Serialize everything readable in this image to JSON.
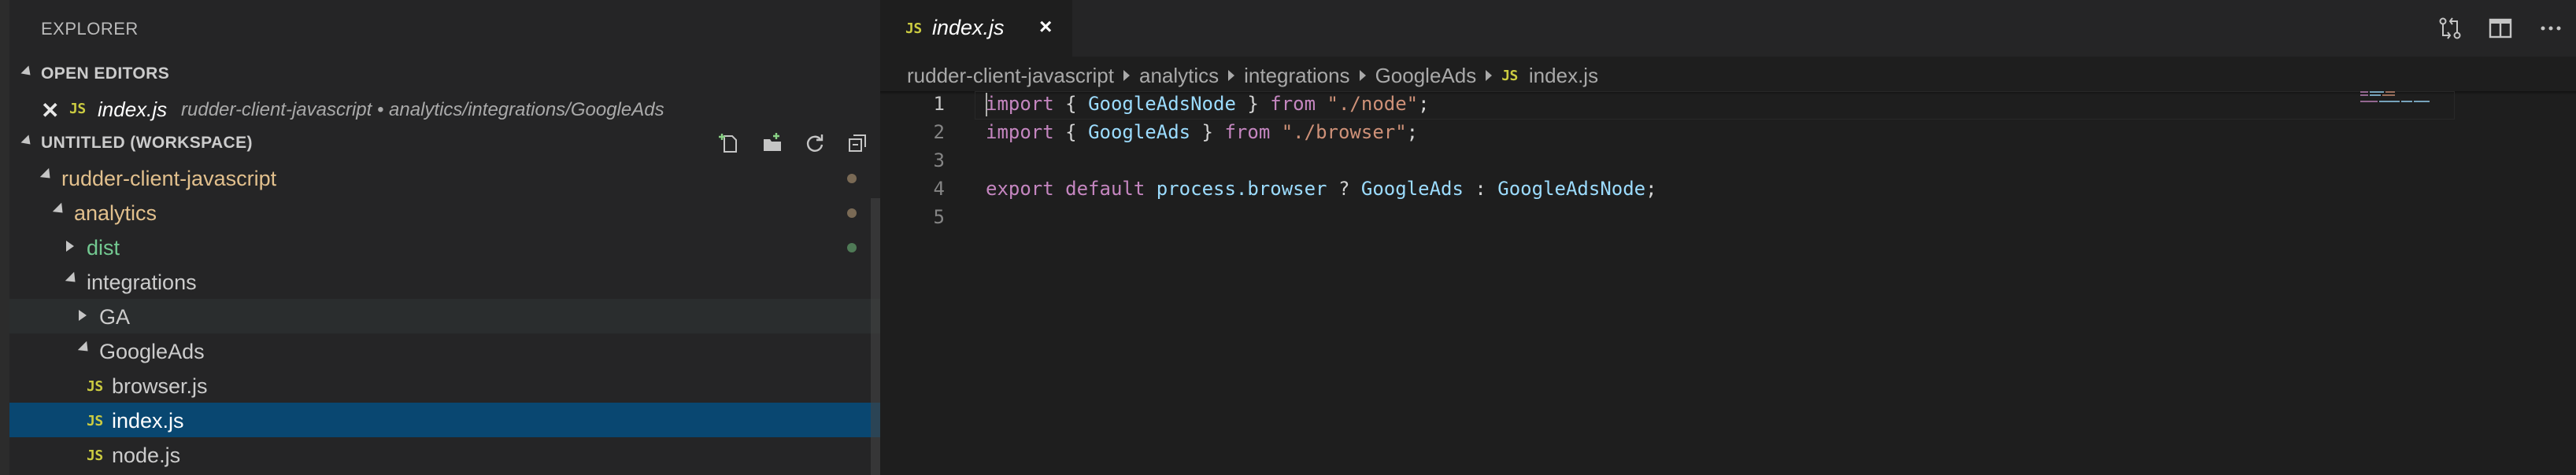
{
  "sidebar": {
    "title": "EXPLORER",
    "open_editors": {
      "header": "OPEN EDITORS",
      "items": [
        {
          "badge": "JS",
          "name": "index.js",
          "path": "rudder-client-javascript • analytics/integrations/GoogleAds"
        }
      ]
    },
    "workspace": {
      "header": "UNTITLED (WORKSPACE)",
      "tree": [
        {
          "label": "rudder-client-javascript",
          "color": "#e2c08d",
          "dot": "#7a6a55"
        },
        {
          "label": "analytics",
          "color": "#e2c08d",
          "dot": "#7a6a55"
        },
        {
          "label": "dist",
          "color": "#73c991",
          "dot": "#4f7a56"
        },
        {
          "label": "integrations",
          "color": "#cccccc"
        },
        {
          "label": "GA",
          "color": "#cccccc"
        },
        {
          "label": "GoogleAds",
          "color": "#cccccc"
        },
        {
          "badge": "JS",
          "label": "browser.js",
          "color": "#cccccc"
        },
        {
          "badge": "JS",
          "label": "index.js",
          "color": "#ffffff"
        },
        {
          "badge": "JS",
          "label": "node.js",
          "color": "#cccccc"
        }
      ]
    }
  },
  "editor": {
    "tab": {
      "badge": "JS",
      "label": "index.js",
      "close": "×"
    },
    "breadcrumb": {
      "items": [
        "rudder-client-javascript",
        "analytics",
        "integrations",
        "GoogleAds"
      ],
      "file_badge": "JS",
      "file": "index.js"
    },
    "lines": [
      {
        "n": "1",
        "t1": "import",
        "t2": " { ",
        "t3": "GoogleAdsNode",
        "t4": " } ",
        "t5": "from",
        "t6": " ",
        "t7": "\"./node\"",
        "t8": ";"
      },
      {
        "n": "2",
        "t1": "import",
        "t2": " { ",
        "t3": "GoogleAds",
        "t4": " } ",
        "t5": "from",
        "t6": " ",
        "t7": "\"./browser\"",
        "t8": ";"
      },
      {
        "n": "3"
      },
      {
        "n": "4",
        "t1": "export",
        "t2": " ",
        "t3": "default",
        "t4": " ",
        "t5": "process.browser",
        "t6": " ? ",
        "t7": "GoogleAds",
        "t8": " : ",
        "t9": "GoogleAdsNode",
        "t10": ";"
      },
      {
        "n": "5"
      }
    ]
  },
  "icons": {
    "js_badge_color": "#cbcb41",
    "selection_color": "#094771"
  }
}
